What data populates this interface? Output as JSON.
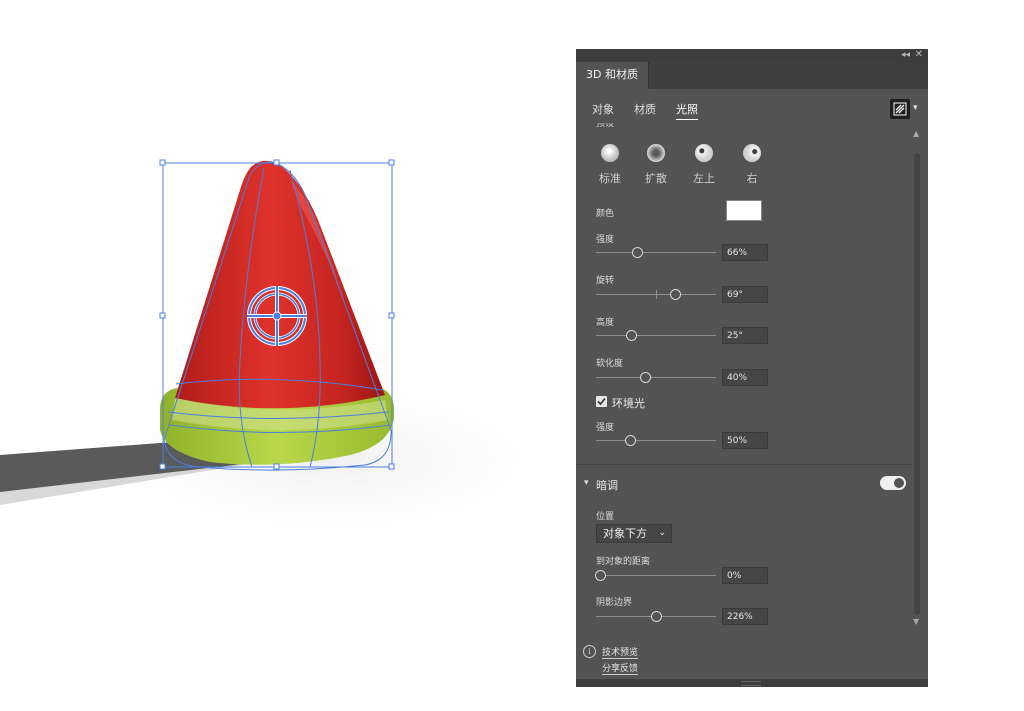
{
  "panel": {
    "title": "3D 和材质",
    "subtabs": [
      "对象",
      "材质",
      "光照"
    ],
    "active_subtab": "光照",
    "top_clipped_label": "预设",
    "presets": [
      {
        "label": "标准",
        "icon": "light-standard-icon"
      },
      {
        "label": "扩散",
        "icon": "light-diffuse-icon"
      },
      {
        "label": "左上",
        "icon": "light-top-left-icon"
      },
      {
        "label": "右",
        "icon": "light-right-icon"
      }
    ],
    "color": {
      "label": "颜色",
      "value": "#ffffff"
    },
    "intensity": {
      "label": "强度",
      "value": "66%",
      "level": 0.33
    },
    "rotation": {
      "label": "旋转",
      "value": "69°",
      "level": 0.67
    },
    "height": {
      "label": "高度",
      "value": "25°",
      "level": 0.28
    },
    "softness": {
      "label": "软化度",
      "value": "40%",
      "level": 0.4
    },
    "ambient": {
      "label": "环境光",
      "checked": true,
      "intensity_label": "强度",
      "intensity_value": "50%",
      "level": 0.27
    },
    "shadows": {
      "title": "暗调",
      "enabled": true,
      "position_label": "位置",
      "position_value": "对象下方",
      "distance_label": "到对象的距离",
      "distance_value": "0%",
      "distance_level": 0.0,
      "bounds_label": "阴影边界",
      "bounds_value": "226%",
      "bounds_level": 0.5
    },
    "footer_links": [
      "技术预览",
      "分享反馈"
    ]
  },
  "colors": {
    "panel_bg": "#535353",
    "watermelon_red": "#d32a26",
    "rind_green": "#a8c83a",
    "selection_blue": "#4a7fe0"
  }
}
